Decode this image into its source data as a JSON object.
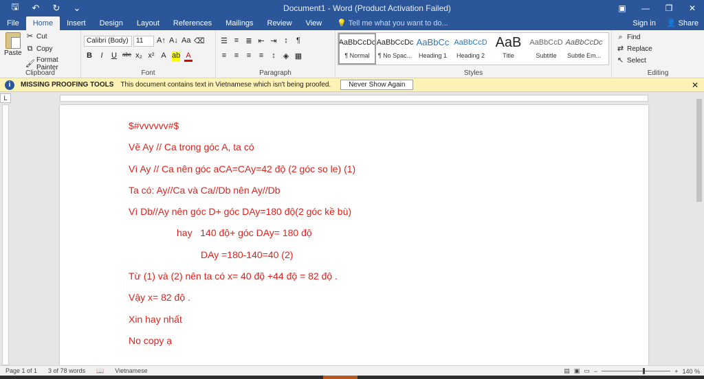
{
  "window": {
    "title": "Document1 - Word (Product Activation Failed)"
  },
  "tabs": [
    {
      "label": "File"
    },
    {
      "label": "Home"
    },
    {
      "label": "Insert"
    },
    {
      "label": "Design"
    },
    {
      "label": "Layout"
    },
    {
      "label": "References"
    },
    {
      "label": "Mailings"
    },
    {
      "label": "Review"
    },
    {
      "label": "View"
    }
  ],
  "tellme": {
    "placeholder": "Tell me what you want to do..."
  },
  "account": {
    "signin": "Sign in",
    "share": "Share"
  },
  "clipboard": {
    "paste": "Paste",
    "cut": "Cut",
    "copy": "Copy",
    "format_painter": "Format Painter",
    "label": "Clipboard"
  },
  "font": {
    "name": "Calibri (Body)",
    "size": "11",
    "label": "Font"
  },
  "paragraph": {
    "label": "Paragraph"
  },
  "styles": {
    "items": [
      {
        "preview": "AaBbCcDc",
        "name": "¶ Normal"
      },
      {
        "preview": "AaBbCcDc",
        "name": "¶ No Spac..."
      },
      {
        "preview": "AaBbCc",
        "name": "Heading 1"
      },
      {
        "preview": "AaBbCcD",
        "name": "Heading 2"
      },
      {
        "preview": "AaB",
        "name": "Title"
      },
      {
        "preview": "AaBbCcD",
        "name": "Subtitle"
      },
      {
        "preview": "AaBbCcDc",
        "name": "Subtle Em..."
      }
    ],
    "label": "Styles"
  },
  "editing": {
    "find": "Find",
    "replace": "Replace",
    "select": "Select",
    "label": "Editing"
  },
  "message_bar": {
    "title": "MISSING PROOFING TOOLS",
    "text": "This document contains text in Vietnamese which isn't being proofed.",
    "button": "Never Show Again"
  },
  "document": {
    "lines": [
      "$#vvvvvv#$",
      "Vẽ Ay // Ca trong góc A, ta có",
      "Vì Ay // Ca nên góc aCA=CAy=42 độ (2 góc so le) (1)",
      "Ta có: Ay//Ca và Ca//Db nên Ay//Db",
      "Vì Db//Ay nên góc D+ góc DAy=180 độ(2 góc kề bù)",
      "                  hay   140 độ+ góc DAy= 180 độ",
      "                           DAy =180-140=40 (2)",
      "Từ (1) và (2) nên ta có x= 40 độ +44 độ = 82 độ .",
      "Vậy x= 82 độ .",
      "Xin hay nhất",
      "No copy ạ"
    ]
  },
  "status": {
    "page": "Page 1 of 1",
    "words": "3 of 78 words",
    "language": "Vietnamese",
    "zoom": "140 %"
  }
}
